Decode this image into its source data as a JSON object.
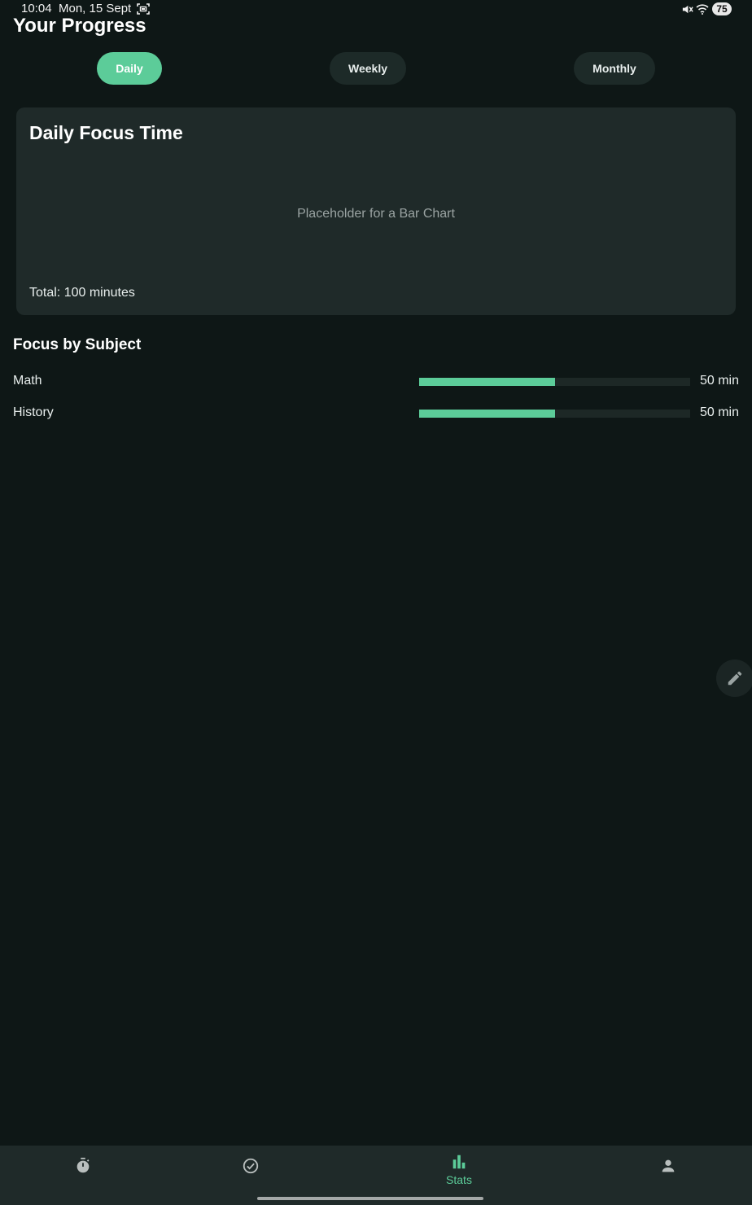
{
  "status_bar": {
    "time": "10:04",
    "date": "Mon, 15 Sept",
    "battery": "75"
  },
  "page_title": "Your Progress",
  "tabs": [
    {
      "label": "Daily",
      "active": true
    },
    {
      "label": "Weekly",
      "active": false
    },
    {
      "label": "Monthly",
      "active": false
    }
  ],
  "chart_card": {
    "title": "Daily Focus Time",
    "placeholder": "Placeholder for a Bar Chart",
    "total": "Total: 100 minutes"
  },
  "focus_by_subject": {
    "title": "Focus by Subject",
    "subjects": [
      {
        "name": "Math",
        "minutes_label": "50 min",
        "progress": 0.5
      },
      {
        "name": "History",
        "minutes_label": "50 min",
        "progress": 0.5
      }
    ]
  },
  "bottom_nav": {
    "items": [
      {
        "icon": "timer-icon",
        "label": ""
      },
      {
        "icon": "check-circle-icon",
        "label": ""
      },
      {
        "icon": "bar-chart-icon",
        "label": "Stats",
        "active": true
      },
      {
        "icon": "person-icon",
        "label": ""
      }
    ]
  },
  "colors": {
    "accent": "#5ccc99",
    "background": "#0e1716",
    "card": "#1f2a29"
  }
}
